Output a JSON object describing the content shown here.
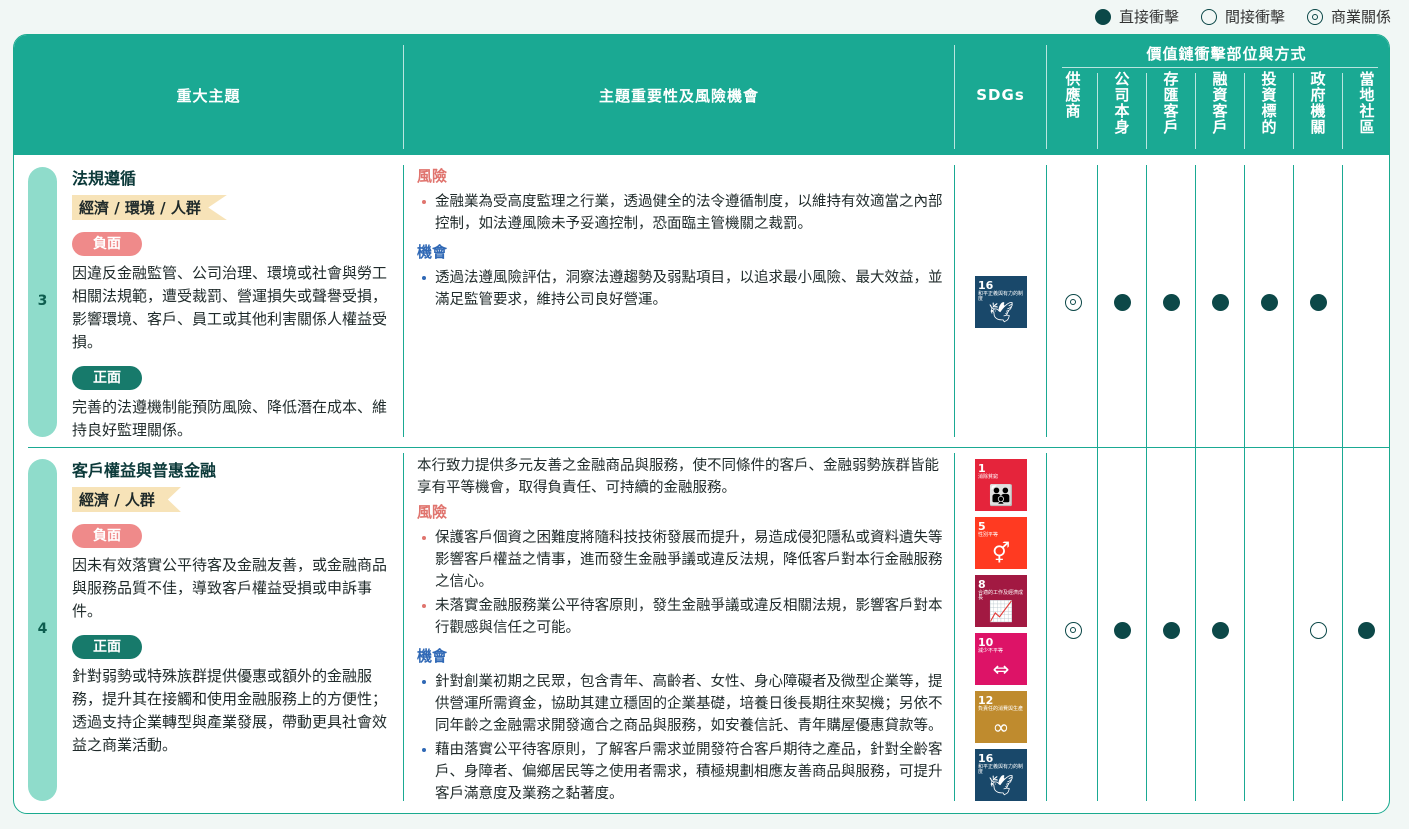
{
  "legend": [
    {
      "label": "直接衝擊",
      "type": "filled"
    },
    {
      "label": "間接衝擊",
      "type": "open"
    },
    {
      "label": "商業關係",
      "type": "circled"
    }
  ],
  "header": {
    "topic": "重大主題",
    "importance": "主題重要性及風險機會",
    "sdgs": "SDGs",
    "value_chain": "價值鏈衝擊部位與方式",
    "stakeholders": [
      "供應商",
      "公司本身",
      "存匯客戶",
      "融資客戶",
      "投資標的",
      "政府機關",
      "當地社區"
    ]
  },
  "rows": [
    {
      "num": "3",
      "topic": "法規遵循",
      "aspects": "經濟 / 環境 / 人群",
      "negative_label": "負面",
      "negative": "因違反金融監管、公司治理、環境或社會與勞工相關法規範，遭受裁罰、營運損失或聲譽受損，影響環境、客戶、員工或其他利害關係人權益受損。",
      "positive_label": "正面",
      "positive": "完善的法遵機制能預防風險、降低潛在成本、維持良好監理關係。",
      "risk_label": "風險",
      "risks": [
        "金融業為受高度監理之行業，透過健全的法令遵循制度，以維持有效適當之內部控制，如法遵風險未予妥適控制，恐面臨主管機關之裁罰。"
      ],
      "opp_label": "機會",
      "opps": [
        "透過法遵風險評估，洞察法遵趨勢及弱點項目，以追求最小風險、最大效益，並滿足監管要求，維持公司良好營運。"
      ],
      "sdgs": [
        {
          "num": "16",
          "text": "和平正義與有力的制度",
          "color": "#19486a",
          "icon": "dove-icon"
        }
      ],
      "impacts": [
        "circled",
        "filled",
        "filled",
        "filled",
        "filled",
        "filled",
        ""
      ]
    },
    {
      "num": "4",
      "topic": "客戶權益與普惠金融",
      "aspects": "經濟 / 人群",
      "negative_label": "負面",
      "negative": "因未有效落實公平待客及金融友善，或金融商品與服務品質不佳，導致客戶權益受損或申訴事件。",
      "positive_label": "正面",
      "positive": "針對弱勢或特殊族群提供優惠或額外的金融服務，提升其在接觸和使用金融服務上的方便性；透過支持企業轉型與產業發展，帶動更具社會效益之商業活動。",
      "intro": "本行致力提供多元友善之金融商品與服務，使不同條件的客戶、金融弱勢族群皆能享有平等機會，取得負責任、可持續的金融服務。",
      "risk_label": "風險",
      "risks": [
        "保護客戶個資之困難度將隨科技技術發展而提升，易造成侵犯隱私或資料遺失等影響客戶權益之情事，進而發生金融爭議或違反法規，降低客戶對本行金融服務之信心。",
        "未落實金融服務業公平待客原則，發生金融爭議或違反相關法規，影響客戶對本行觀感與信任之可能。"
      ],
      "opp_label": "機會",
      "opps": [
        "針對創業初期之民眾，包含青年、高齡者、女性、身心障礙者及微型企業等，提供營運所需資金，協助其建立穩固的企業基礎，培養日後長期往來契機；另依不同年齡之金融需求開發適合之商品與服務，如安養信託、青年購屋優惠貸款等。",
        "藉由落實公平待客原則，了解客戶需求並開發符合客戶期待之產品，針對全齡客戶、身障者、偏鄉居民等之使用者需求，積極規劃相應友善商品與服務，可提升客戶滿意度及業務之黏著度。"
      ],
      "sdgs": [
        {
          "num": "1",
          "text": "消除貧窮",
          "color": "#e5243b",
          "icon": "people-icon"
        },
        {
          "num": "5",
          "text": "性別平等",
          "color": "#ff3a21",
          "icon": "gender-icon"
        },
        {
          "num": "8",
          "text": "合適的工作及經濟成長",
          "color": "#a21942",
          "icon": "growth-chart-icon"
        },
        {
          "num": "10",
          "text": "減少不平等",
          "color": "#dd1367",
          "icon": "equality-arrows-icon"
        },
        {
          "num": "12",
          "text": "負責任的消費與生產",
          "color": "#bf8b2e",
          "icon": "infinity-icon"
        },
        {
          "num": "16",
          "text": "和平正義與有力的制度",
          "color": "#19486a",
          "icon": "dove-icon"
        }
      ],
      "impacts": [
        "circled",
        "filled",
        "filled",
        "filled",
        "",
        "open",
        "filled"
      ]
    }
  ]
}
